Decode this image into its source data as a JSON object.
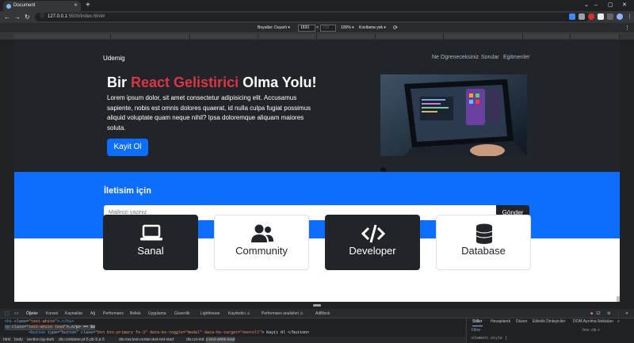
{
  "browser": {
    "tab_title": "Document",
    "new_tab": "+",
    "url_host": "127.0.0.1",
    "url_rest": ":5500/index.html#",
    "win_min": "–",
    "win_max": "▢",
    "win_close": "✕"
  },
  "device_toolbar": {
    "dimensions_label": "Boyutlar: Duyarlı ▾",
    "width": "1830",
    "times": "×",
    "height_placeholder": "716",
    "zoom": "100% ▾",
    "throttle": "Kısıtlama yok ▾"
  },
  "site": {
    "brand": "Udemig",
    "nav": [
      "Ne Ogreneceksiniz",
      "Sorular",
      "Egitmenler"
    ],
    "hero": {
      "title_pre": "Bir ",
      "title_accent": "React Gelistirici",
      "title_post": " Olma Yolu!",
      "lead": "Lorem ipsum dolor, sit amet consectetur adipisicing elit. Accusamus sapiente, nobis est omnis dolores quaerat, id nulla culpa fugiat possimus aliquid voluptate quam neque nihil? Ipsa doloremque aliquam maiores soluta.",
      "cta": "Kayit Ol"
    },
    "contact": {
      "title": "İletisim için",
      "placeholder": "Mailinizi yaziniz",
      "button": "Gönder"
    },
    "cards": [
      {
        "label": "Sanal",
        "icon": "laptop-icon",
        "dark": true
      },
      {
        "label": "Community",
        "icon": "users-icon",
        "dark": false
      },
      {
        "label": "Developer",
        "icon": "code-icon",
        "dark": true
      },
      {
        "label": "Database",
        "icon": "database-icon",
        "dark": false
      }
    ]
  },
  "devtools": {
    "tabs": [
      "Öğeler",
      "Konsol",
      "Kaynaklar",
      "Ağ",
      "Performans",
      "Bellek",
      "Uygulama",
      "Güvenlik",
      "Lighthouse",
      "Kaydedici ⚠",
      "Performans analizleri ⚠",
      "AdBlock"
    ],
    "issues_count": "12",
    "elements": [
      {
        "tag_open": "<h1 ",
        "attr": "class=",
        "val": "\"text-white\"",
        "rest": ">…</h1>"
      },
      {
        "tag_open": "<p ",
        "attr": "class=",
        "val": "\"text-white lead\"",
        "rest": ">…</p> == $0"
      },
      {
        "tag_open": "<button ",
        "attr": "type=\"button\" class=",
        "val": "\"btn btn-primary fs-3\" data-bs-toggle=\"modal\" data-bs-target=\"#enroll\"",
        "rest": "> Kayit Ol </button>"
      }
    ],
    "breadcrumbs": [
      "html",
      "body",
      "section.bg-dark",
      "div.container.pt-5.pb-5.p-5",
      "div.row.text-center.text-md-start",
      "div.col-md",
      "p.text-white.lead"
    ],
    "styles_tabs": [
      "Stiller",
      "Hesaplandı",
      "Düzen",
      "Etkinlik Dinleyiciler",
      "DOM Ayrılma Noktaları",
      "»"
    ],
    "filter": "Filtre",
    "filter_right": ":hov  .cls  +",
    "element_style": "element.style {"
  }
}
